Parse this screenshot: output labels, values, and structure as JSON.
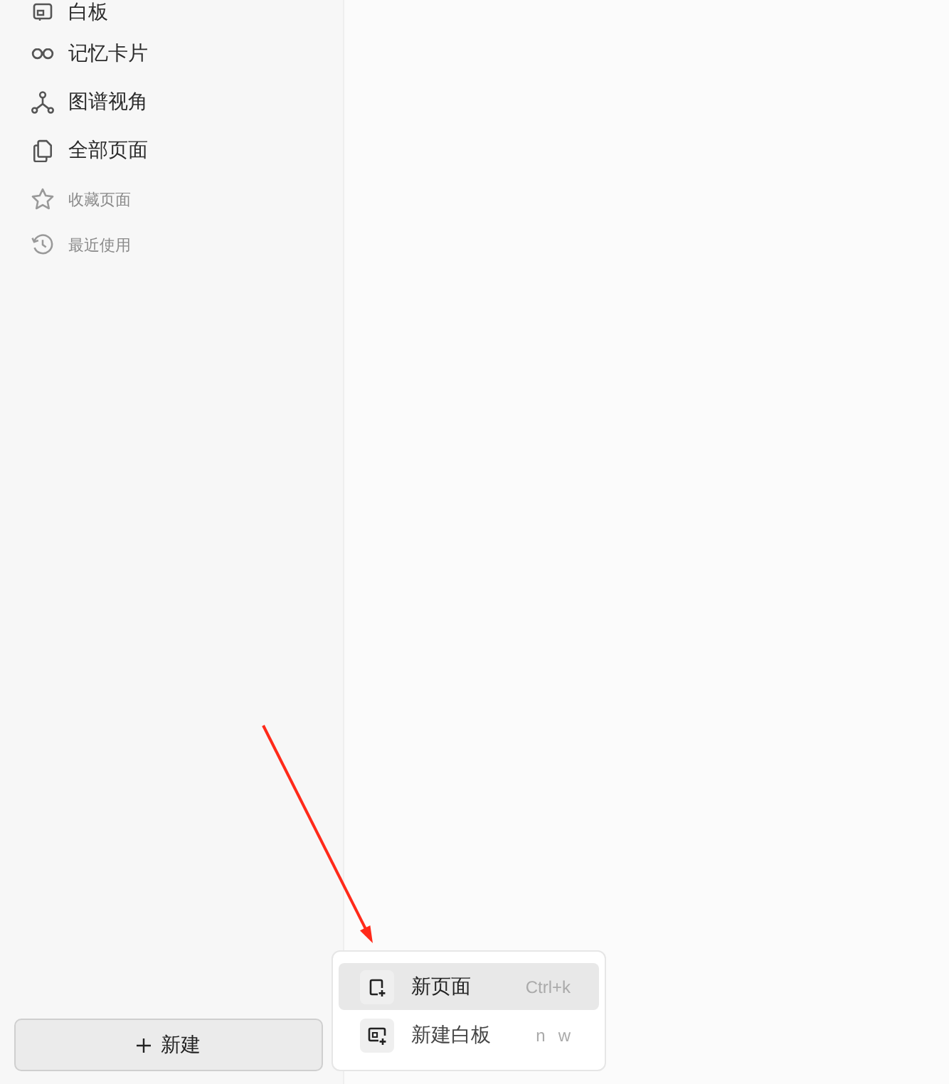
{
  "sidebar": {
    "nav_items": [
      {
        "label": "白板",
        "kind": "whiteboard"
      },
      {
        "label": "记忆卡片",
        "kind": "flashcards"
      },
      {
        "label": "图谱视角",
        "kind": "graph"
      },
      {
        "label": "全部页面",
        "kind": "all-pages"
      }
    ],
    "sections": [
      {
        "label": "收藏页面",
        "kind": "favorites"
      },
      {
        "label": "最近使用",
        "kind": "recent"
      }
    ],
    "new_button": {
      "label": "新建"
    }
  },
  "new_menu": {
    "items": [
      {
        "label": "新页面",
        "kind": "page",
        "shortcut": [
          "Ctrl+k"
        ],
        "selected": true
      },
      {
        "label": "新建白板",
        "kind": "whiteboard",
        "shortcut": [
          "n",
          "w"
        ],
        "selected": false
      }
    ]
  },
  "annotations": [
    {
      "kind": "arrow"
    }
  ]
}
